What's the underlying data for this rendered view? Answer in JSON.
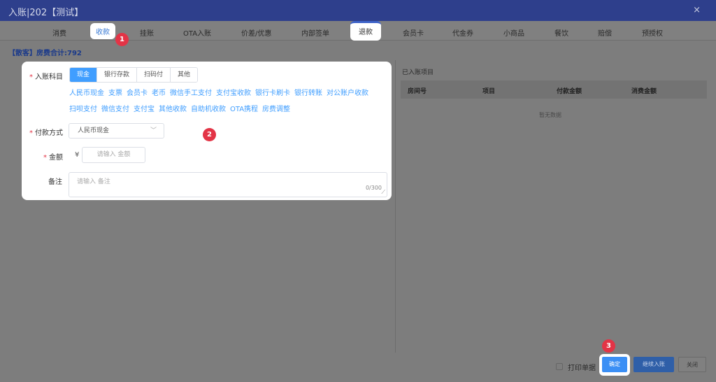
{
  "window": {
    "title": "入账|202【测试】",
    "close_glyph": "×"
  },
  "tabs": [
    {
      "label": "消费"
    },
    {
      "label": "收款"
    },
    {
      "label": "挂账"
    },
    {
      "label": "OTA入账"
    },
    {
      "label": "价差/优惠"
    },
    {
      "label": "内部签单"
    },
    {
      "label": "退款"
    },
    {
      "label": "会员卡"
    },
    {
      "label": "代金券"
    },
    {
      "label": "小商品"
    },
    {
      "label": "餐饮"
    },
    {
      "label": "赔偿"
    },
    {
      "label": "预授权"
    }
  ],
  "badges": [
    "1",
    "2",
    "3"
  ],
  "summary": "【散客】房费合计:792",
  "form": {
    "subject_label": "入账科目",
    "segments": [
      {
        "label": "现金"
      },
      {
        "label": "银行存款"
      },
      {
        "label": "扫码付"
      },
      {
        "label": "其他"
      }
    ],
    "links_row1": [
      {
        "label": "人民币现金"
      },
      {
        "label": "支票"
      },
      {
        "label": "会员卡"
      },
      {
        "label": "老币"
      },
      {
        "label": "微信手工支付"
      },
      {
        "label": "支付宝收款"
      },
      {
        "label": "银行卡刷卡"
      },
      {
        "label": "银行转账"
      },
      {
        "label": "对公账户收款"
      }
    ],
    "links_row2": [
      {
        "label": "扫呗支付"
      },
      {
        "label": "微信支付"
      },
      {
        "label": "支付宝"
      },
      {
        "label": "其他收款"
      },
      {
        "label": "自助机收款"
      },
      {
        "label": "OTA携程"
      },
      {
        "label": "房费调整"
      }
    ],
    "payment_label": "付款方式",
    "payment_value": "人民币现金",
    "amount_label": "金额",
    "currency": "¥",
    "amount_placeholder": "请输入 金额",
    "remark_label": "备注",
    "remark_placeholder": "请输入 备注",
    "remark_count": "0/300"
  },
  "right_panel": {
    "title": "已入账项目",
    "columns": [
      "房间号",
      "项目",
      "付款金额",
      "消费金额"
    ],
    "empty_text": "暂无数据"
  },
  "footer": {
    "print_label": "打印单据",
    "ok_label": "确定",
    "continue_label": "继续入账",
    "close_label": "关闭"
  }
}
